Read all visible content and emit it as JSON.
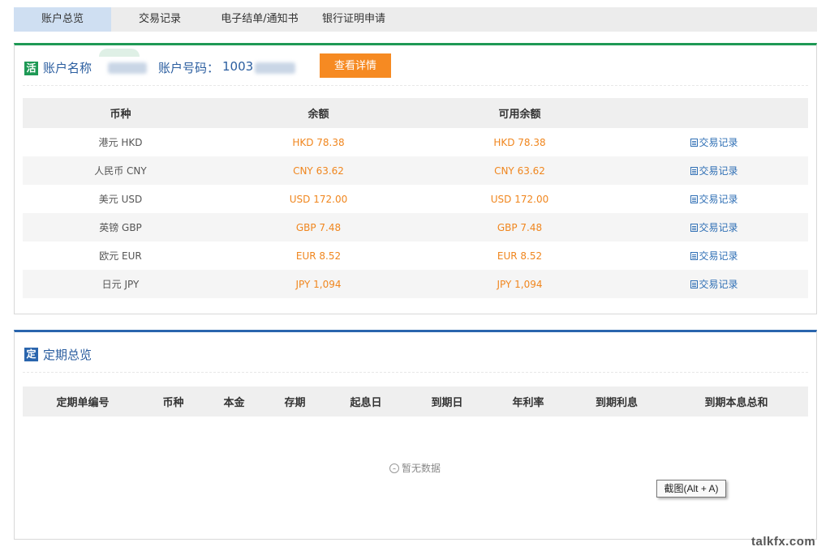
{
  "tabs": [
    {
      "label": "账户总览",
      "active": true
    },
    {
      "label": "交易记录",
      "active": false
    },
    {
      "label": "电子结单/通知书",
      "active": false
    },
    {
      "label": "银行证明申请",
      "active": false
    }
  ],
  "account": {
    "badge": "活",
    "name_label": "账户名称",
    "number_label": "账户号码：",
    "number_visible": "1003",
    "detail_button": "查看详情",
    "columns": [
      "币种",
      "余额",
      "可用余额",
      ""
    ],
    "rows": [
      {
        "currency": "港元 HKD",
        "balance": "HKD 78.38",
        "available": "HKD 78.38",
        "link": "交易记录"
      },
      {
        "currency": "人民币 CNY",
        "balance": "CNY 63.62",
        "available": "CNY 63.62",
        "link": "交易记录"
      },
      {
        "currency": "美元 USD",
        "balance": "USD 172.00",
        "available": "USD 172.00",
        "link": "交易记录"
      },
      {
        "currency": "英镑 GBP",
        "balance": "GBP 7.48",
        "available": "GBP 7.48",
        "link": "交易记录"
      },
      {
        "currency": "欧元 EUR",
        "balance": "EUR 8.52",
        "available": "EUR 8.52",
        "link": "交易记录"
      },
      {
        "currency": "日元 JPY",
        "balance": "JPY 1,094",
        "available": "JPY 1,094",
        "link": "交易记录"
      }
    ]
  },
  "deposit": {
    "badge": "定",
    "title": "定期总览",
    "columns": [
      "定期单编号",
      "币种",
      "本金",
      "存期",
      "起息日",
      "到期日",
      "年利率",
      "到期利息",
      "到期本息总和"
    ],
    "empty_text": "暂无数据"
  },
  "tooltip": "截图(Alt + A)",
  "watermark": "talkfx.com",
  "colors": {
    "accent_green": "#1e9955",
    "accent_blue": "#2a65ad",
    "amount_orange": "#f0861e",
    "button_orange": "#f68a22"
  },
  "icons": {
    "record_link": "document-icon",
    "empty": "sad-face-icon"
  }
}
